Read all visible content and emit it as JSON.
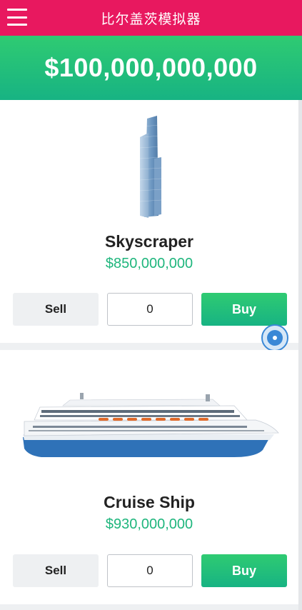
{
  "header": {
    "title": "比尔盖茨模拟器",
    "menu_icon": "hamburger-menu-icon",
    "color": "#e8185f"
  },
  "balance": {
    "amount": "$100,000,000,000",
    "color": "#2fcb72"
  },
  "items": [
    {
      "name": "Skyscraper",
      "price": "$850,000,000",
      "image_icon": "skyscraper-icon",
      "sell_label": "Sell",
      "quantity": "0",
      "buy_label": "Buy"
    },
    {
      "name": "Cruise Ship",
      "price": "$930,000,000",
      "image_icon": "cruise-ship-icon",
      "sell_label": "Sell",
      "quantity": "0",
      "buy_label": "Buy"
    }
  ],
  "floating_button": {
    "icon": "assistive-touch-icon"
  },
  "colors": {
    "accent_green": "#1fb67d",
    "buy_button": "#2fcb72"
  }
}
